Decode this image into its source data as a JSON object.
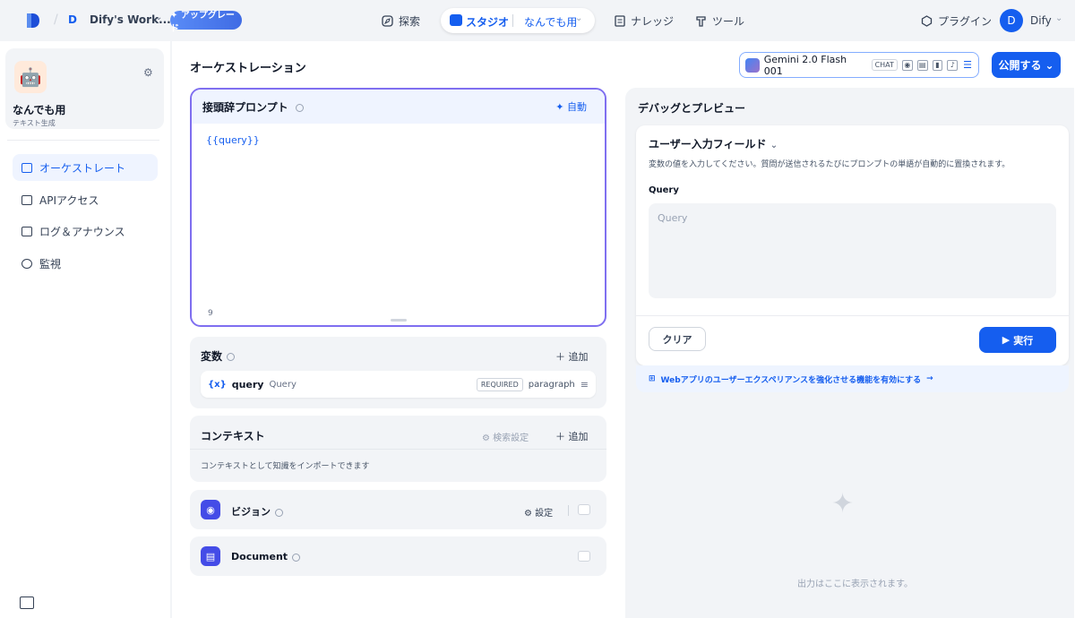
{
  "topbar": {
    "workspace_initial": "D",
    "workspace_name": "Dify's Work...",
    "upgrade_label": "✦ アップグレード",
    "nav": {
      "explore": "探索",
      "studio": "スタジオ",
      "app_selector": "なんでも用",
      "knowledge": "ナレッジ",
      "tools": "ツール"
    },
    "plugin_label": "プラグイン",
    "user_initial": "D",
    "user_name": "Dify"
  },
  "sidebar": {
    "app_title": "なんでも用",
    "app_type": "テキスト生成",
    "items": [
      {
        "label": "オーケストレート",
        "active": true
      },
      {
        "label": "APIアクセス",
        "active": false
      },
      {
        "label": "ログ＆アナウンス",
        "active": false
      },
      {
        "label": "監視",
        "active": false
      }
    ]
  },
  "orchestration": {
    "title": "オーケストレーション",
    "model_name": "Gemini 2.0 Flash 001",
    "model_mode": "CHAT",
    "publish_label": "公開する",
    "prompt": {
      "title": "接頭辞プロンプト",
      "auto_label": "自動",
      "content": "{{query}}",
      "char_count": "9"
    },
    "variables": {
      "title": "変数",
      "add_label": "追加",
      "rows": [
        {
          "key": "query",
          "name": "Query",
          "required": "REQUIRED",
          "type": "paragraph"
        }
      ]
    },
    "context": {
      "title": "コンテキスト",
      "retrieval_settings": "検索設定",
      "add_label": "追加",
      "hint": "コンテキストとして知識をインポートできます"
    },
    "vision": {
      "title": "ビジョン",
      "settings_label": "設定"
    },
    "document": {
      "title": "Document"
    }
  },
  "debug": {
    "title": "デバッグとプレビュー",
    "input_fields_title": "ユーザー入力フィールド",
    "input_fields_desc": "変数の値を入力してください。質問が送信されるたびにプロンプトの単語が自動的に置換されます。",
    "query_label": "Query",
    "query_placeholder": "Query",
    "clear_label": "クリア",
    "run_label": "実行",
    "webapp_hint": "Webアプリのユーザーエクスペリアンスを強化させる機能を有効にする",
    "empty_text": "出力はここに表示されます。"
  },
  "colors": {
    "accent": "#155eef",
    "prompt_border": "#7f6ff0",
    "feature_icon": "#444ce7"
  }
}
